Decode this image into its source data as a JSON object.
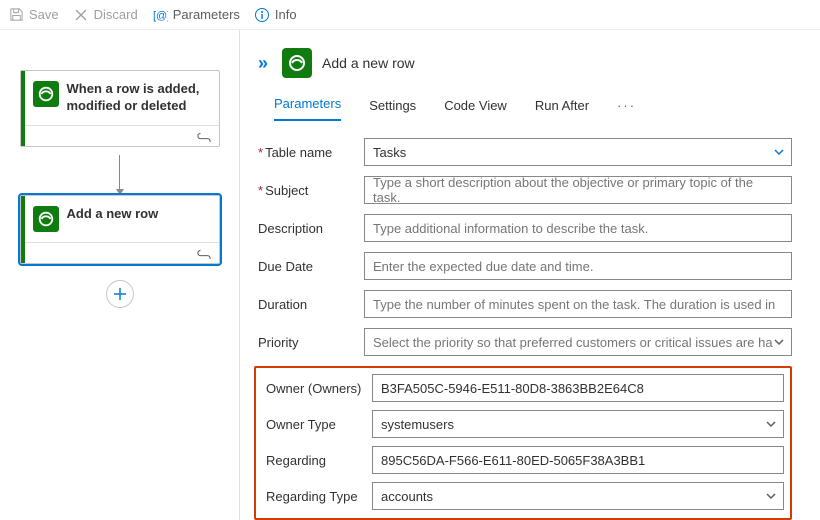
{
  "toolbar": {
    "save": "Save",
    "discard": "Discard",
    "parameters": "Parameters",
    "info": "Info"
  },
  "flow": {
    "trigger": {
      "title": "When a row is added, modified or deleted"
    },
    "action": {
      "title": "Add a new row"
    }
  },
  "panel": {
    "title": "Add a new row",
    "tabs": {
      "parameters": "Parameters",
      "settings": "Settings",
      "codeview": "Code View",
      "runafter": "Run After"
    },
    "fields": {
      "tablename": {
        "label": "Table name",
        "value": "Tasks"
      },
      "subject": {
        "label": "Subject",
        "placeholder": "Type a short description about the objective or primary topic of the task."
      },
      "description": {
        "label": "Description",
        "placeholder": "Type additional information to describe the task."
      },
      "duedate": {
        "label": "Due Date",
        "placeholder": "Enter the expected due date and time."
      },
      "duration": {
        "label": "Duration",
        "placeholder": "Type the number of minutes spent on the task. The duration is used in"
      },
      "priority": {
        "label": "Priority",
        "placeholder": "Select the priority so that preferred customers or critical issues are ha"
      },
      "owner": {
        "label": "Owner (Owners)",
        "value": "B3FA505C-5946-E511-80D8-3863BB2E64C8"
      },
      "ownertype": {
        "label": "Owner Type",
        "value": "systemusers"
      },
      "regarding": {
        "label": "Regarding",
        "value": "895C56DA-F566-E611-80ED-5065F38A3BB1"
      },
      "regardingtype": {
        "label": "Regarding Type",
        "value": "accounts"
      }
    }
  }
}
